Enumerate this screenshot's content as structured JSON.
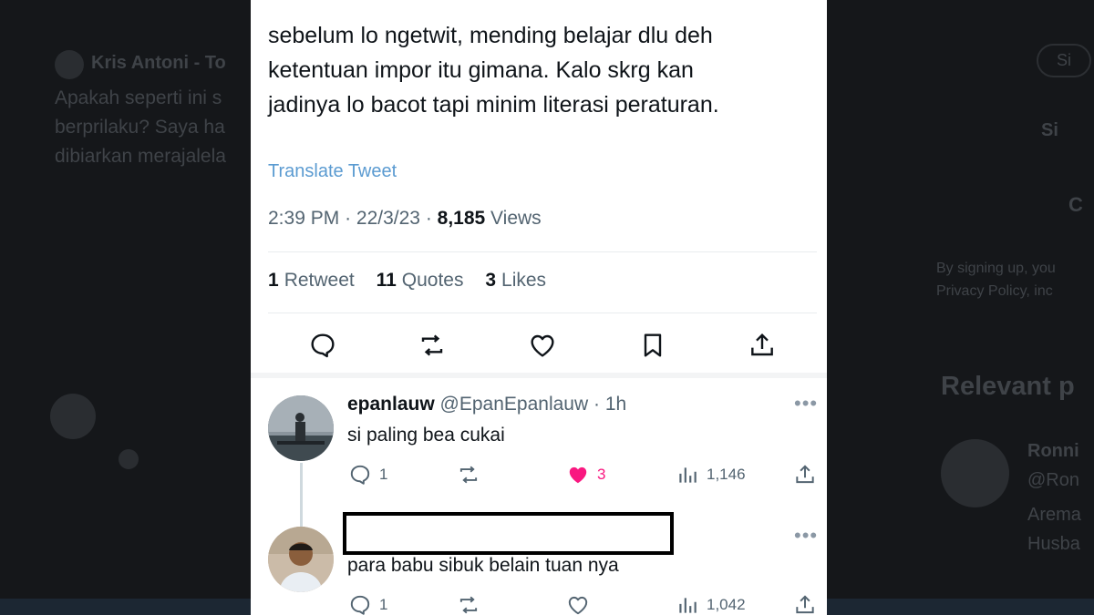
{
  "background": {
    "left_author": "Kris Antoni - To",
    "left_text": [
      "Apakah seperti ini s",
      "berprilaku? Saya ha",
      "dibiarkan merajalela"
    ],
    "right_signin_google": "Si",
    "right_signin_apple": "Si",
    "right_create": "C",
    "right_terms": [
      "By signing up, you",
      "Privacy Policy, inc"
    ],
    "relevant_people": "Relevant p",
    "right_person": "Ronni",
    "right_person_handle": "@Ron",
    "right_person_bio": [
      "Arema",
      "Husba"
    ]
  },
  "tweet": {
    "text_lines": [
      "sebelum lo ngetwit, mending belajar dlu deh",
      "ketentuan impor itu gimana. Kalo skrg kan",
      "jadinya lo bacot tapi minim literasi peraturan."
    ],
    "translate_label": "Translate Tweet",
    "time": "2:39 PM",
    "date": "22/3/23",
    "views_count": "8,185",
    "views_label": "Views",
    "retweets_count": "1",
    "retweets_label": "Retweet",
    "quotes_count": "11",
    "quotes_label": "Quotes",
    "likes_count": "3",
    "likes_label": "Likes"
  },
  "actions": [
    "reply-icon",
    "retweet-icon",
    "like-icon",
    "bookmark-icon",
    "share-icon"
  ],
  "replies": [
    {
      "name": "epanlauw",
      "handle": "@EpanEpanlauw",
      "time": "1h",
      "text": "si paling bea cukai",
      "reply_count": "1",
      "like_count": "3",
      "views": "1,146"
    },
    {
      "name": "",
      "handle": "",
      "time": "",
      "text": "para babu sibuk belain tuan nya",
      "reply_count": "1",
      "like_count": "",
      "views": "1,042"
    }
  ],
  "colors": {
    "link": "#5b9bd1",
    "like_active": "#f91880",
    "muted": "#536471",
    "text": "#0f1419"
  }
}
